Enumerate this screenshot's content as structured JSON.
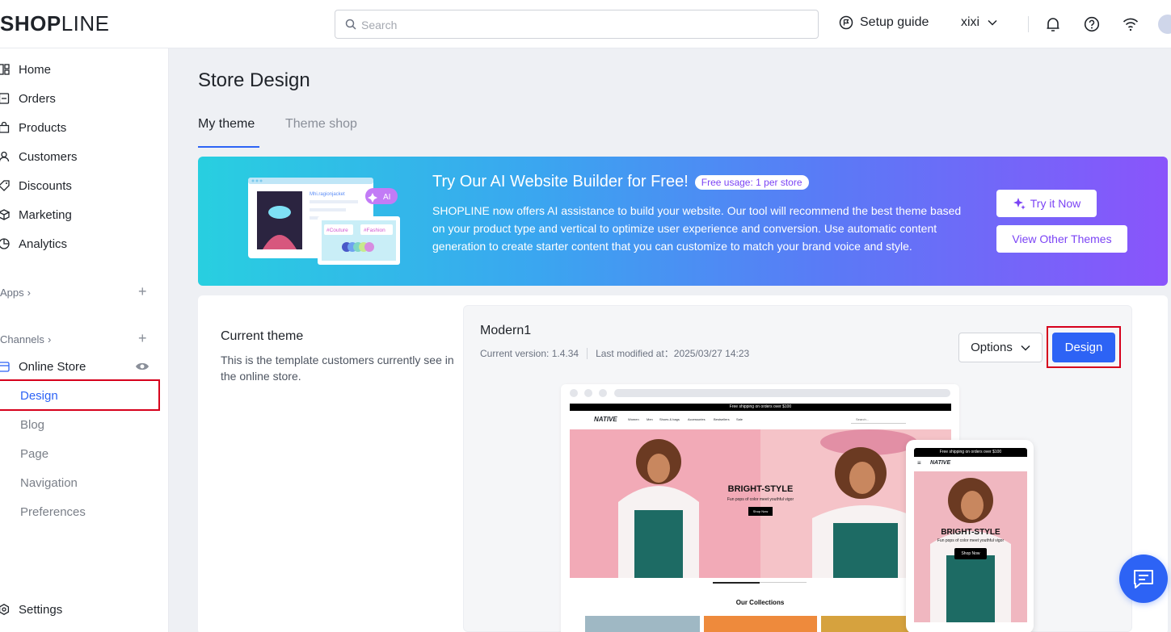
{
  "app": {
    "logo_bold": "SHOP",
    "logo_light": "LINE"
  },
  "header": {
    "search_placeholder": "Search",
    "setup_guide": "Setup guide",
    "user_name": "xixi"
  },
  "sidebar": {
    "items": [
      {
        "label": "Home",
        "icon": "home-icon"
      },
      {
        "label": "Orders",
        "icon": "orders-icon"
      },
      {
        "label": "Products",
        "icon": "products-icon"
      },
      {
        "label": "Customers",
        "icon": "customers-icon"
      },
      {
        "label": "Discounts",
        "icon": "discounts-icon"
      },
      {
        "label": "Marketing",
        "icon": "marketing-icon"
      },
      {
        "label": "Analytics",
        "icon": "analytics-icon"
      }
    ],
    "apps_label": "Apps",
    "channels_label": "Channels",
    "online_store": "Online Store",
    "sub_items": [
      "Design",
      "Blog",
      "Page",
      "Navigation",
      "Preferences"
    ],
    "settings": "Settings"
  },
  "main": {
    "title": "Store Design",
    "tabs": [
      "My theme",
      "Theme shop"
    ],
    "banner": {
      "title": "Try Our AI Website Builder for Free!",
      "badge": "Free usage: 1 per store",
      "description": "SHOPLINE now offers AI assistance to build your website. Our tool will recommend the best theme based on your product type and vertical to optimize user experience and conversion. Use automatic content generation to create starter content that you can customize to match your brand voice and style.",
      "try_button": "Try it Now",
      "view_button": "View Other Themes",
      "illustration": {
        "ai_chip": "AI",
        "tag1": "#Couture",
        "tag2": "#Fashion",
        "caption": "Mhi.ragionjacket"
      }
    },
    "current_theme": {
      "heading": "Current theme",
      "description": "This is the template customers currently see in the online store.",
      "name": "Modern1",
      "version": "Current version: 1.4.34",
      "last_modified": "Last modified at：2025/03/27 14:23",
      "options_button": "Options",
      "design_button": "Design"
    },
    "preview": {
      "strip": "Free shipping on orders over $100",
      "brand": "NATIVE",
      "nav": [
        "Women",
        "Men",
        "Shoes & bags",
        "Accessories",
        "Bestsellers",
        "Sale"
      ],
      "search": "Search...",
      "hero_title": "BRIGHT-STYLE",
      "hero_sub": "Fun pops of color meet youthful vigor",
      "hero_button": "Shop Now",
      "collections": "Our Collections"
    }
  },
  "colors": {
    "accent": "#2d63f5",
    "highlight_box": "#d6001c",
    "banner_purple": "#7b43f5"
  }
}
